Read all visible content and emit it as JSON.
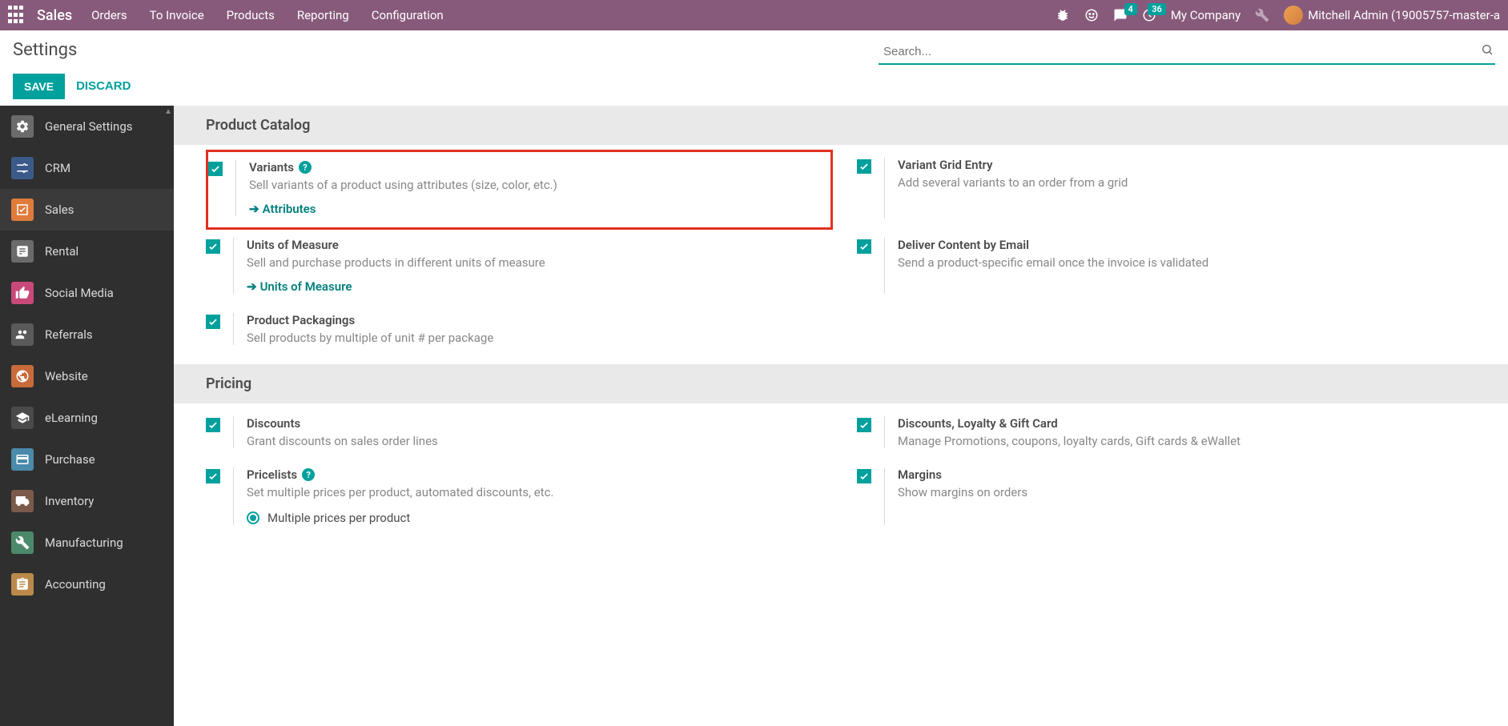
{
  "topbar": {
    "brand": "Sales",
    "nav": [
      "Orders",
      "To Invoice",
      "Products",
      "Reporting",
      "Configuration"
    ],
    "messages_badge": "4",
    "activities_badge": "36",
    "company": "My Company",
    "user": "Mitchell Admin (19005757-master-a"
  },
  "control_panel": {
    "title": "Settings",
    "save": "SAVE",
    "discard": "DISCARD",
    "search_placeholder": "Search..."
  },
  "sidebar": [
    {
      "label": "General Settings",
      "color": "#6b6b6b"
    },
    {
      "label": "CRM",
      "color": "#3a5a8a"
    },
    {
      "label": "Sales",
      "color": "#e07b3c",
      "active": true
    },
    {
      "label": "Rental",
      "color": "#6b6b6b"
    },
    {
      "label": "Social Media",
      "color": "#c94a7a"
    },
    {
      "label": "Referrals",
      "color": "#5a5a5a"
    },
    {
      "label": "Website",
      "color": "#c96a3a"
    },
    {
      "label": "eLearning",
      "color": "#4a4a4a"
    },
    {
      "label": "Purchase",
      "color": "#4a8aaa"
    },
    {
      "label": "Inventory",
      "color": "#7a5a4a"
    },
    {
      "label": "Manufacturing",
      "color": "#4a8a6a"
    },
    {
      "label": "Accounting",
      "color": "#ba8a4a"
    }
  ],
  "sections": {
    "product_catalog": {
      "title": "Product Catalog",
      "variants": {
        "title": "Variants",
        "desc": "Sell variants of a product using attributes (size, color, etc.)",
        "link": "Attributes"
      },
      "variant_grid": {
        "title": "Variant Grid Entry",
        "desc": "Add several variants to an order from a grid"
      },
      "uom": {
        "title": "Units of Measure",
        "desc": "Sell and purchase products in different units of measure",
        "link": "Units of Measure"
      },
      "deliver_email": {
        "title": "Deliver Content by Email",
        "desc": "Send a product-specific email once the invoice is validated"
      },
      "packagings": {
        "title": "Product Packagings",
        "desc": "Sell products by multiple of unit # per package"
      }
    },
    "pricing": {
      "title": "Pricing",
      "discounts": {
        "title": "Discounts",
        "desc": "Grant discounts on sales order lines"
      },
      "loyalty": {
        "title": "Discounts, Loyalty & Gift Card",
        "desc": "Manage Promotions, coupons, loyalty cards, Gift cards & eWallet"
      },
      "pricelists": {
        "title": "Pricelists",
        "desc": "Set multiple prices per product, automated discounts, etc.",
        "radio": "Multiple prices per product"
      },
      "margins": {
        "title": "Margins",
        "desc": "Show margins on orders"
      }
    }
  }
}
